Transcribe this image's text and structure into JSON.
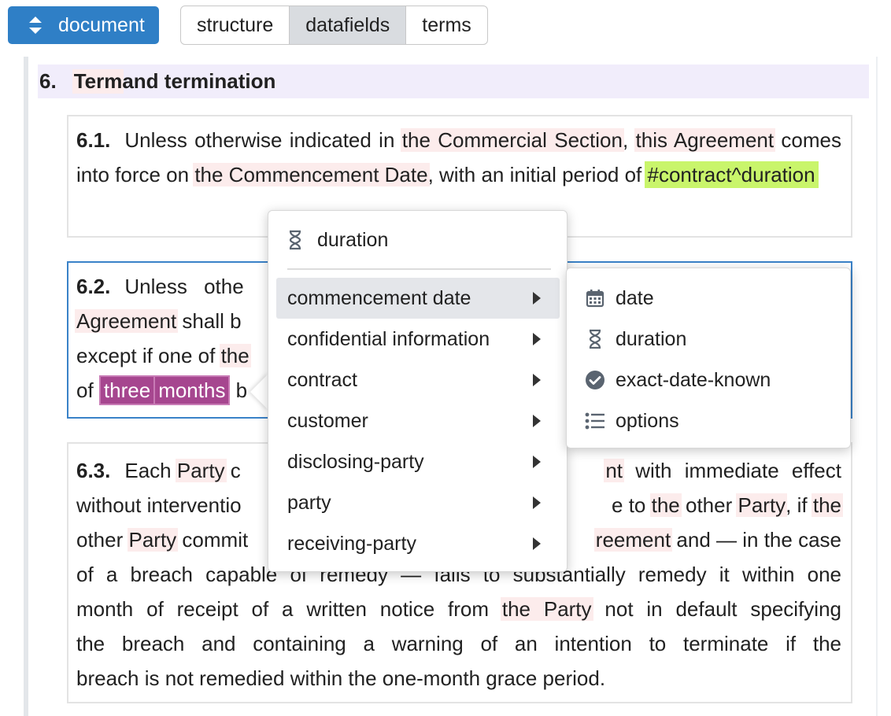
{
  "toolbar": {
    "document_label": "document",
    "tabs": [
      {
        "label": "structure"
      },
      {
        "label": "datafields"
      },
      {
        "label": "terms"
      }
    ],
    "active_tab": "datafields"
  },
  "section": {
    "number": "6.",
    "title_part1": "Term",
    "title_part2": " and termination"
  },
  "clause_6_1": {
    "number": "6.1.",
    "t1": "Unless otherwise indicated in ",
    "h1": "the Commercial Section",
    "t2": ", ",
    "h2": "this Agreement",
    "t3": " comes into force on ",
    "h3": "the Commencement Date",
    "t4": ", with an initial period of ",
    "field": "#contract^duration"
  },
  "clause_6_2": {
    "number": "6.2.",
    "t1": "Unless ",
    "t2": "othe",
    "h1": "Agreement",
    "t3": " shall b",
    "t4": "except if one of ",
    "h2": "the",
    "t5": "of ",
    "p1": "three",
    "p2": "months",
    "t6": " b"
  },
  "clause_6_3": {
    "number": "6.3.",
    "l1_a": "Each ",
    "l1_h1": "Party",
    "l1_b": " c",
    "l1_c": "nt",
    "l1_d": " with immediate effect",
    "l2_a": "without interventio",
    "l2_b": "e to ",
    "l2_h1": "the",
    "l2_c": " other ",
    "l2_h2": "Party",
    "l2_d": ", if ",
    "l2_h3": "the",
    "l3_a": "other ",
    "l3_h1": "Party",
    "l3_b": " commit",
    "l3_h2": "reement",
    "l3_c": " and — in the case",
    "l4": "of a breach capable of remedy — fails to substantially remedy it within one",
    "l5_a": "month of receipt of a written notice from ",
    "l5_h1": "the Party",
    "l5_b": " not in default specifying",
    "l6": "the breach and containing a warning of an intention to terminate if the",
    "l7": "breach is not remedied within the one-month grace period."
  },
  "menu": {
    "header_icon": "hourglass-icon",
    "header_label": "duration",
    "items": [
      {
        "label": "commencement date"
      },
      {
        "label": "confidential information"
      },
      {
        "label": "contract"
      },
      {
        "label": "customer"
      },
      {
        "label": "disclosing-party"
      },
      {
        "label": "party"
      },
      {
        "label": "receiving-party"
      }
    ],
    "active_item": "commencement date"
  },
  "submenu": {
    "items": [
      {
        "label": "date",
        "icon": "calendar-icon"
      },
      {
        "label": "duration",
        "icon": "hourglass-icon"
      },
      {
        "label": "exact-date-known",
        "icon": "check-circle-icon"
      },
      {
        "label": "options",
        "icon": "list-icon"
      }
    ]
  },
  "colors": {
    "primary": "#2f7fc6",
    "header_bg": "#f1edfb",
    "term_highlight": "#fcecec",
    "field_green": "#c9f56b",
    "field_purple": "#a6468f"
  }
}
